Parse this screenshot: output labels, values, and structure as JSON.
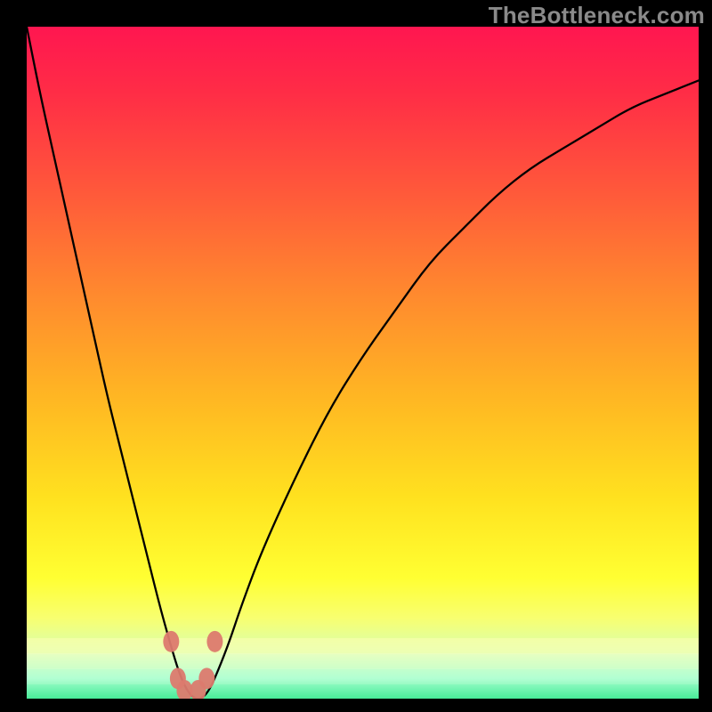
{
  "watermark": "TheBottleneck.com",
  "chart_data": {
    "type": "line",
    "title": "",
    "xlabel": "",
    "ylabel": "",
    "xlim": [
      0,
      100
    ],
    "ylim": [
      0,
      100
    ],
    "x": [
      0,
      2,
      4,
      6,
      8,
      10,
      12,
      14,
      16,
      18,
      20,
      22,
      23,
      24,
      25,
      26,
      27,
      28,
      30,
      32,
      35,
      40,
      45,
      50,
      55,
      60,
      65,
      70,
      75,
      80,
      85,
      90,
      95,
      100
    ],
    "y": [
      100,
      90,
      81,
      72,
      63,
      54,
      45,
      37,
      29,
      21,
      13,
      6,
      3,
      1,
      0,
      0,
      1,
      3,
      8,
      14,
      22,
      33,
      43,
      51,
      58,
      65,
      70,
      75,
      79,
      82,
      85,
      88,
      90,
      92
    ],
    "gradient_stops": [
      {
        "pos": 0.0,
        "color": "#ff1650"
      },
      {
        "pos": 0.1,
        "color": "#ff2d46"
      },
      {
        "pos": 0.25,
        "color": "#ff5a3a"
      },
      {
        "pos": 0.4,
        "color": "#ff8a2e"
      },
      {
        "pos": 0.55,
        "color": "#ffb623"
      },
      {
        "pos": 0.7,
        "color": "#ffe11f"
      },
      {
        "pos": 0.82,
        "color": "#ffff32"
      },
      {
        "pos": 0.88,
        "color": "#f8ff70"
      },
      {
        "pos": 0.93,
        "color": "#d8ffb0"
      },
      {
        "pos": 0.97,
        "color": "#88ffcc"
      },
      {
        "pos": 1.0,
        "color": "#00e07a"
      }
    ],
    "safe_band": {
      "bottom": 0,
      "top": 9
    },
    "dots": [
      {
        "x": 21.5,
        "y": 8.5
      },
      {
        "x": 22.5,
        "y": 3.0
      },
      {
        "x": 23.5,
        "y": 1.2
      },
      {
        "x": 25.5,
        "y": 1.2
      },
      {
        "x": 26.8,
        "y": 3.0
      },
      {
        "x": 28.0,
        "y": 8.5
      }
    ],
    "dot_color": "#dc7a6e",
    "curve_color": "#000000"
  }
}
